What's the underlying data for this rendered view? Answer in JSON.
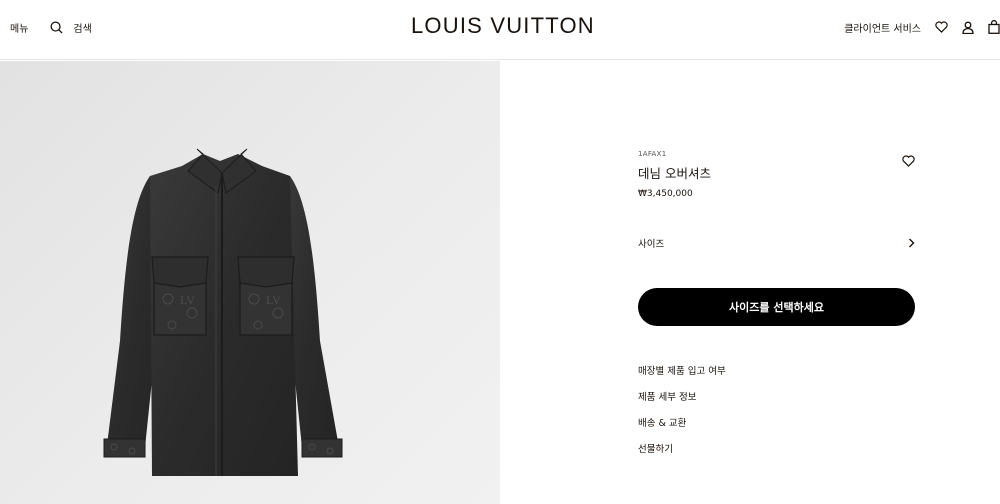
{
  "header": {
    "menu_label": "메뉴",
    "search_label": "검색",
    "logo": "LOUIS VUITTON",
    "client_service": "클라이언트 서비스"
  },
  "product": {
    "sku": "1AFAX1",
    "name": "데님 오버셔츠",
    "price": "₩3,450,000",
    "image_alt": "black denim overshirt with monogram pockets"
  },
  "size": {
    "label": "사이즈"
  },
  "cta": {
    "label": "사이즈를 선택하세요"
  },
  "links": [
    {
      "label": "매장별 제품 입고 여부"
    },
    {
      "label": "제품 세부 정보"
    },
    {
      "label": "배송 & 교환"
    },
    {
      "label": "선물하기"
    }
  ],
  "colors": {
    "text": "#19110b",
    "cta_bg": "#000000",
    "image_bg": "#e8e8e8"
  }
}
